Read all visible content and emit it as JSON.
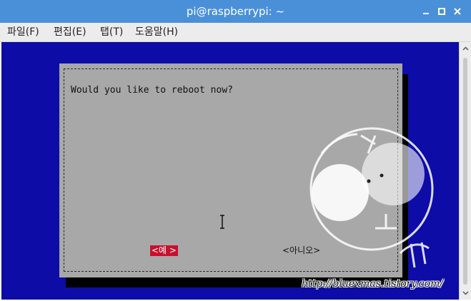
{
  "window": {
    "title": "pi@raspberrypi: ~",
    "controls": [
      "minimize-icon",
      "maximize-icon",
      "close-icon"
    ]
  },
  "menu": {
    "items": [
      "파일(F)",
      "편집(E)",
      "탭(T)",
      "도움말(H)"
    ]
  },
  "dialog": {
    "question": "Would you like to reboot now?",
    "yes_label": "<예 >",
    "no_label": "<아니오>"
  },
  "watermark": {
    "text": "http://bluexmas.tistory.com/"
  },
  "colors": {
    "titlebar": "#4a90d9",
    "terminal_bg": "#0d0ca6",
    "dialog_bg": "#a8a8a8",
    "selected_button": "#c8102e"
  }
}
